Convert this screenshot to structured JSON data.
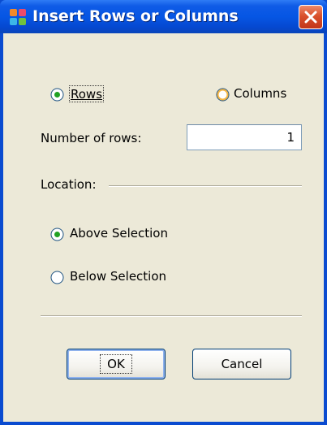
{
  "window": {
    "title": "Insert Rows or Columns",
    "icon": "app-tiles-icon",
    "close_icon": "close-icon",
    "accent": "#0656e4"
  },
  "dialog": {
    "insert_type": {
      "options": [
        {
          "label": "Rows",
          "selected": true
        },
        {
          "label": "Columns",
          "selected": false
        }
      ]
    },
    "count_field": {
      "label": "Number of rows:",
      "value": "1"
    },
    "location": {
      "label": "Location:",
      "options": [
        {
          "label": "Above Selection",
          "selected": true
        },
        {
          "label": "Below Selection",
          "selected": false
        }
      ]
    },
    "buttons": {
      "ok": "OK",
      "cancel": "Cancel"
    }
  }
}
